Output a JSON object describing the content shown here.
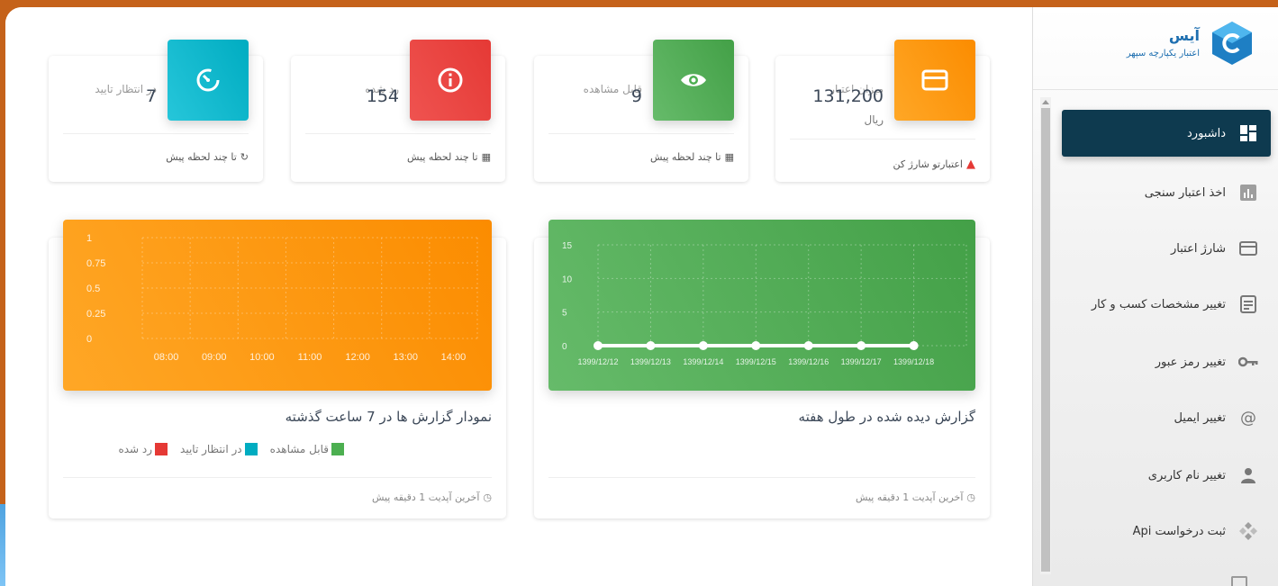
{
  "colors": {
    "orange": "#fb8c00",
    "red": "#e53935",
    "green": "#43a047",
    "cyan": "#00acc1",
    "sidebar_active": "#0e3a4f"
  },
  "brand": {
    "name": "آیس",
    "tagline": "اعتبار یکپارچه سپهر"
  },
  "stats": [
    {
      "label": "میزان اعتبار",
      "value": "131,200",
      "unit": "ریال",
      "footer": "اعتبارتو شارژ کن",
      "footer_icon": "warning-icon",
      "icon": "credit-card-icon"
    },
    {
      "label": "قابل مشاهده",
      "value": "9",
      "footer": "تا چند لحظه پیش",
      "footer_icon": "calendar-icon",
      "icon": "eye-icon"
    },
    {
      "label": "رد شده",
      "value": "154",
      "footer": "تا چند لحظه پیش",
      "footer_icon": "calendar-icon",
      "icon": "info-icon"
    },
    {
      "label": "در انتظار تایید",
      "value": "7",
      "footer": "تا چند لحظه پیش",
      "footer_icon": "history-icon",
      "icon": "timer-icon"
    }
  ],
  "charts": {
    "weekly": {
      "title": "گزارش دیده شده در طول هفته",
      "footer": "آخرین آپدیت 1 دقیقه پیش"
    },
    "hourly": {
      "title": "نمودار گزارش ها در 7 ساعت گذشته",
      "footer": "آخرین آپدیت 1 دقیقه پیش",
      "legend": [
        "قابل مشاهده",
        "در انتظار تایید",
        "رد شده"
      ]
    }
  },
  "chart_data": [
    {
      "type": "line",
      "x": [
        "1399/12/12",
        "1399/12/13",
        "1399/12/14",
        "1399/12/15",
        "1399/12/16",
        "1399/12/17",
        "1399/12/18"
      ],
      "series": [
        {
          "values": [
            0,
            0,
            0,
            0,
            0,
            0,
            0
          ]
        }
      ],
      "ylim": [
        0,
        15
      ],
      "yticks": [
        "0",
        "5",
        "10",
        "15"
      ],
      "grid": true
    },
    {
      "type": "bar",
      "categories": [
        "08:00",
        "09:00",
        "10:00",
        "11:00",
        "12:00",
        "13:00",
        "14:00"
      ],
      "series": [
        {
          "name": "قابل مشاهده",
          "values": [
            0,
            0,
            0,
            0,
            0,
            0,
            0
          ]
        },
        {
          "name": "در انتظار تایید",
          "values": [
            0,
            0,
            0,
            0,
            0,
            0,
            0
          ]
        },
        {
          "name": "رد شده",
          "values": [
            0,
            0,
            0,
            0,
            0,
            0,
            0
          ]
        }
      ],
      "ylim": [
        0,
        1
      ],
      "yticks": [
        "0",
        "0.25",
        "0.5",
        "0.75",
        "1"
      ],
      "grid": true
    }
  ],
  "sidebar": {
    "items": [
      {
        "label": "داشبورد",
        "icon": "dashboard-icon",
        "active": true
      },
      {
        "label": "اخذ اعتبار سنجی",
        "icon": "bar-chart-icon"
      },
      {
        "label": "شارژ اعتبار",
        "icon": "credit-card-icon"
      },
      {
        "label": "تغییر مشخصات کسب و کار",
        "icon": "document-icon"
      },
      {
        "label": "تغییر رمز عبور",
        "icon": "key-icon"
      },
      {
        "label": "تغییر ایمیل",
        "icon": "at-icon"
      },
      {
        "label": "تغییر نام کاربری",
        "icon": "user-icon"
      },
      {
        "label": "ثبت درخواست Api",
        "icon": "api-icon"
      }
    ]
  }
}
